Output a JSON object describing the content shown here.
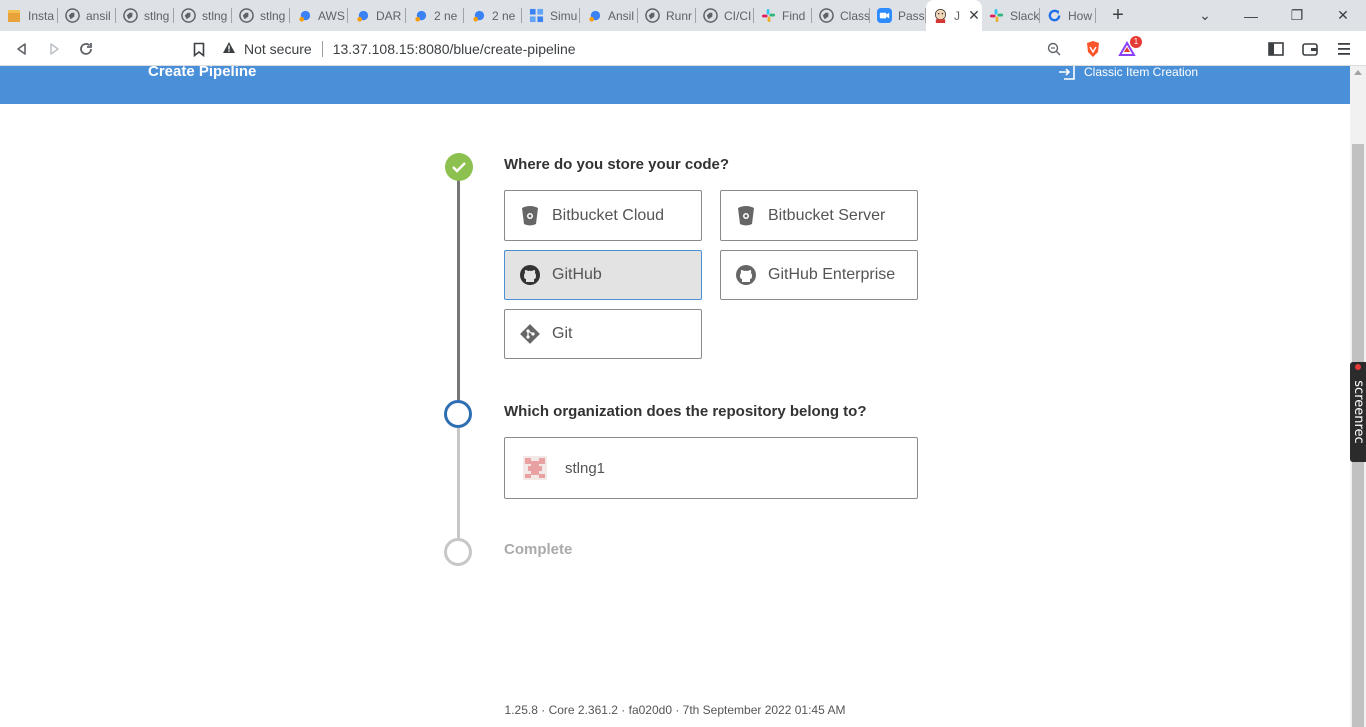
{
  "browser": {
    "tabs": [
      {
        "title": "Insta",
        "icon": "box-icon"
      },
      {
        "title": "ansil",
        "icon": "globe-icon"
      },
      {
        "title": "stlng",
        "icon": "globe-icon"
      },
      {
        "title": "stlng",
        "icon": "globe-icon"
      },
      {
        "title": "stlng",
        "icon": "globe-icon"
      },
      {
        "title": "AWS",
        "icon": "devops-icon"
      },
      {
        "title": "DAR",
        "icon": "devops-icon"
      },
      {
        "title": "2 ne",
        "icon": "devops-icon"
      },
      {
        "title": "2 ne",
        "icon": "devops-icon"
      },
      {
        "title": "Simu",
        "icon": "blocks-icon"
      },
      {
        "title": "Ansil",
        "icon": "devops-icon"
      },
      {
        "title": "Runr",
        "icon": "globe-icon"
      },
      {
        "title": "CI/CI",
        "icon": "globe-icon"
      },
      {
        "title": "Find",
        "icon": "slack-icon"
      },
      {
        "title": "Class",
        "icon": "globe-icon"
      },
      {
        "title": "Pass",
        "icon": "zoom-icon"
      },
      {
        "title": "J",
        "icon": "jenkins-icon"
      },
      {
        "title": "Slack",
        "icon": "slack-icon"
      },
      {
        "title": "How",
        "icon": "refresh-icon"
      }
    ],
    "security_label": "Not secure",
    "url": "13.37.108.15:8080/blue/create-pipeline",
    "brave_badge": "1"
  },
  "header": {
    "title": "Create Pipeline",
    "classic_link": "Classic Item Creation"
  },
  "steps": [
    {
      "title": "Where do you store your code?",
      "state": "done"
    },
    {
      "title": "Which organization does the repository belong to?",
      "state": "current"
    },
    {
      "title": "Complete",
      "state": "pending"
    }
  ],
  "scm_options": [
    {
      "label": "Bitbucket Cloud",
      "icon": "bitbucket-icon",
      "selected": false
    },
    {
      "label": "Bitbucket Server",
      "icon": "bitbucket-icon",
      "selected": false
    },
    {
      "label": "GitHub",
      "icon": "github-icon",
      "selected": true
    },
    {
      "label": "GitHub Enterprise",
      "icon": "github-icon",
      "selected": false
    },
    {
      "label": "Git",
      "icon": "git-icon",
      "selected": false
    }
  ],
  "organizations": [
    {
      "label": "stlng1"
    }
  ],
  "footer": {
    "version": "1.25.8 · Core 2.361.2 · fa020d0 · 7th September 2022 01:45 AM"
  },
  "overlay": {
    "label": "screenrec"
  },
  "colors": {
    "accent": "#4a90d9",
    "done": "#8cc04f",
    "current": "#2e6fb3",
    "pending": "#c7c7c7"
  }
}
